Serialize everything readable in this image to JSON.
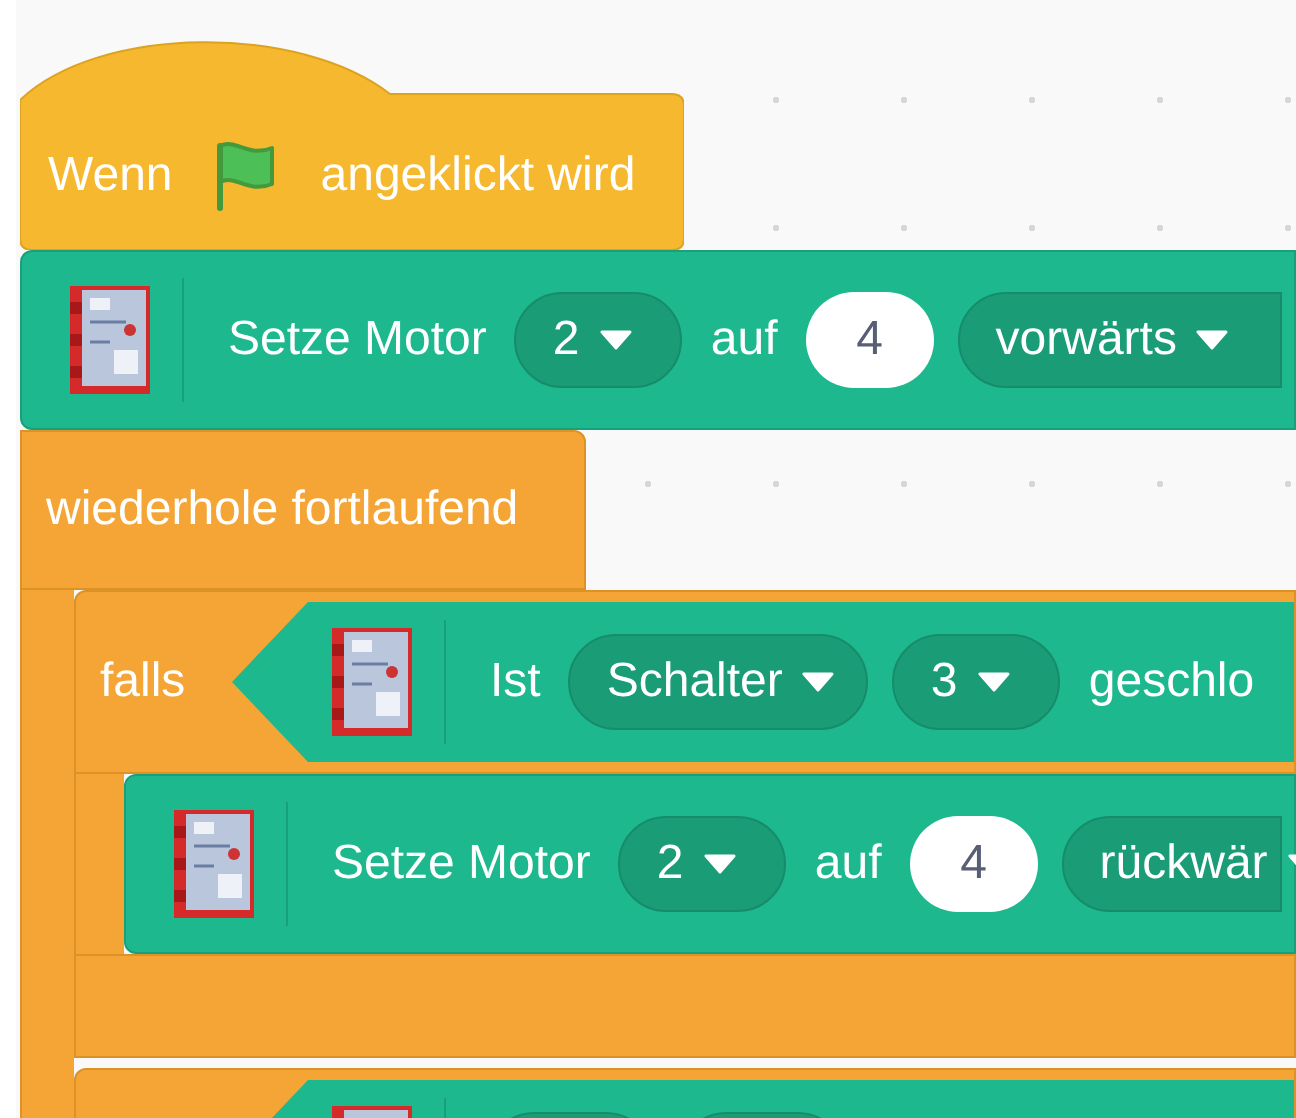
{
  "script": [
    {
      "kind": "hat",
      "parts": [
        {
          "kind": "label",
          "text": "Wenn"
        },
        {
          "kind": "flag"
        },
        {
          "kind": "label",
          "text": "angeklickt wird"
        }
      ]
    },
    {
      "kind": "command",
      "parts": [
        {
          "kind": "label",
          "text": "Setze Motor"
        },
        {
          "kind": "dropdown",
          "text": "2"
        },
        {
          "kind": "label",
          "text": "auf"
        },
        {
          "kind": "number",
          "text": "4"
        },
        {
          "kind": "dropdown",
          "text": "vorwärts"
        }
      ]
    },
    {
      "kind": "forever",
      "label": "wiederhole fortlaufend",
      "body": [
        {
          "kind": "if",
          "label": "falls",
          "condition": [
            {
              "kind": "label",
              "text": "Ist"
            },
            {
              "kind": "dropdown",
              "text": "Schalter"
            },
            {
              "kind": "dropdown",
              "text": "3"
            },
            {
              "kind": "label",
              "text": "geschlo"
            }
          ],
          "body": [
            {
              "kind": "command",
              "parts": [
                {
                  "kind": "label",
                  "text": "Setze Motor"
                },
                {
                  "kind": "dropdown",
                  "text": "2"
                },
                {
                  "kind": "label",
                  "text": "auf"
                },
                {
                  "kind": "number",
                  "text": "4"
                },
                {
                  "kind": "dropdown",
                  "text": "rückwär"
                }
              ]
            }
          ]
        },
        {
          "kind": "if",
          "condition": [
            {
              "kind": "dropdown"
            },
            {
              "kind": "dropdown"
            }
          ]
        }
      ]
    }
  ]
}
